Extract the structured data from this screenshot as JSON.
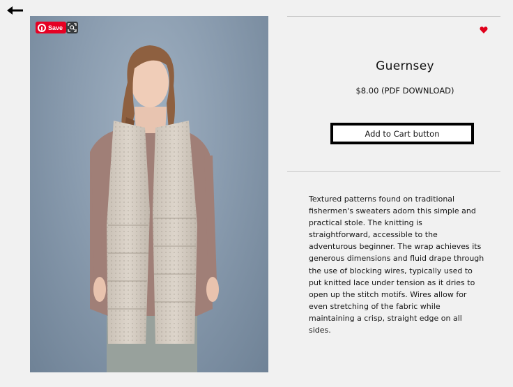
{
  "navigation": {
    "back_icon": "arrow-left-icon"
  },
  "image_overlay": {
    "save_label": "Save",
    "save_icon": "pinterest-icon",
    "visual_search_icon": "visual-search-icon"
  },
  "product": {
    "title": "Guernsey",
    "price": "$8.00 (PDF DOWNLOAD)",
    "add_to_cart_label": "Add to Cart button",
    "favorite_icon": "heart-icon",
    "description": "Textured patterns found on traditional fishermen's sweaters adorn this simple and practical stole. The knitting is straightforward, accessible to the adventurous beginner. The wrap achieves its generous dimensions and fluid drape through the use of blocking wires, typically used to put knitted lace under tension as it dries to open up the stitch motifs. Wires allow for even stretching of the fabric while maintaining a crisp, straight edge on all sides."
  },
  "colors": {
    "background": "#f1f1f1",
    "pinterest_red": "#e60023",
    "heart_red": "#e0001b",
    "button_border": "#000000",
    "divider": "#c6c6c6"
  }
}
